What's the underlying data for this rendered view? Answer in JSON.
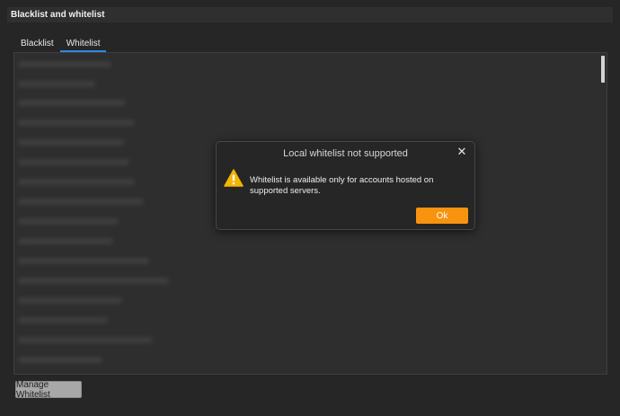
{
  "window": {
    "title": "Blacklist and whitelist"
  },
  "tabs": [
    {
      "label": "Blacklist",
      "active": false
    },
    {
      "label": "Whitelist",
      "active": true
    }
  ],
  "accent_color": "#2f8ae0",
  "list": {
    "item_count": 16,
    "content": "blurred"
  },
  "manage_button": {
    "label": "Manage Whitelist"
  },
  "dialog": {
    "title": "Local whitelist not supported",
    "message": "Whitelist is available only for accounts hosted on supported servers.",
    "ok_label": "Ok",
    "ok_color": "#f7930f",
    "icon": "warning-icon",
    "close_icon": "close-icon"
  }
}
